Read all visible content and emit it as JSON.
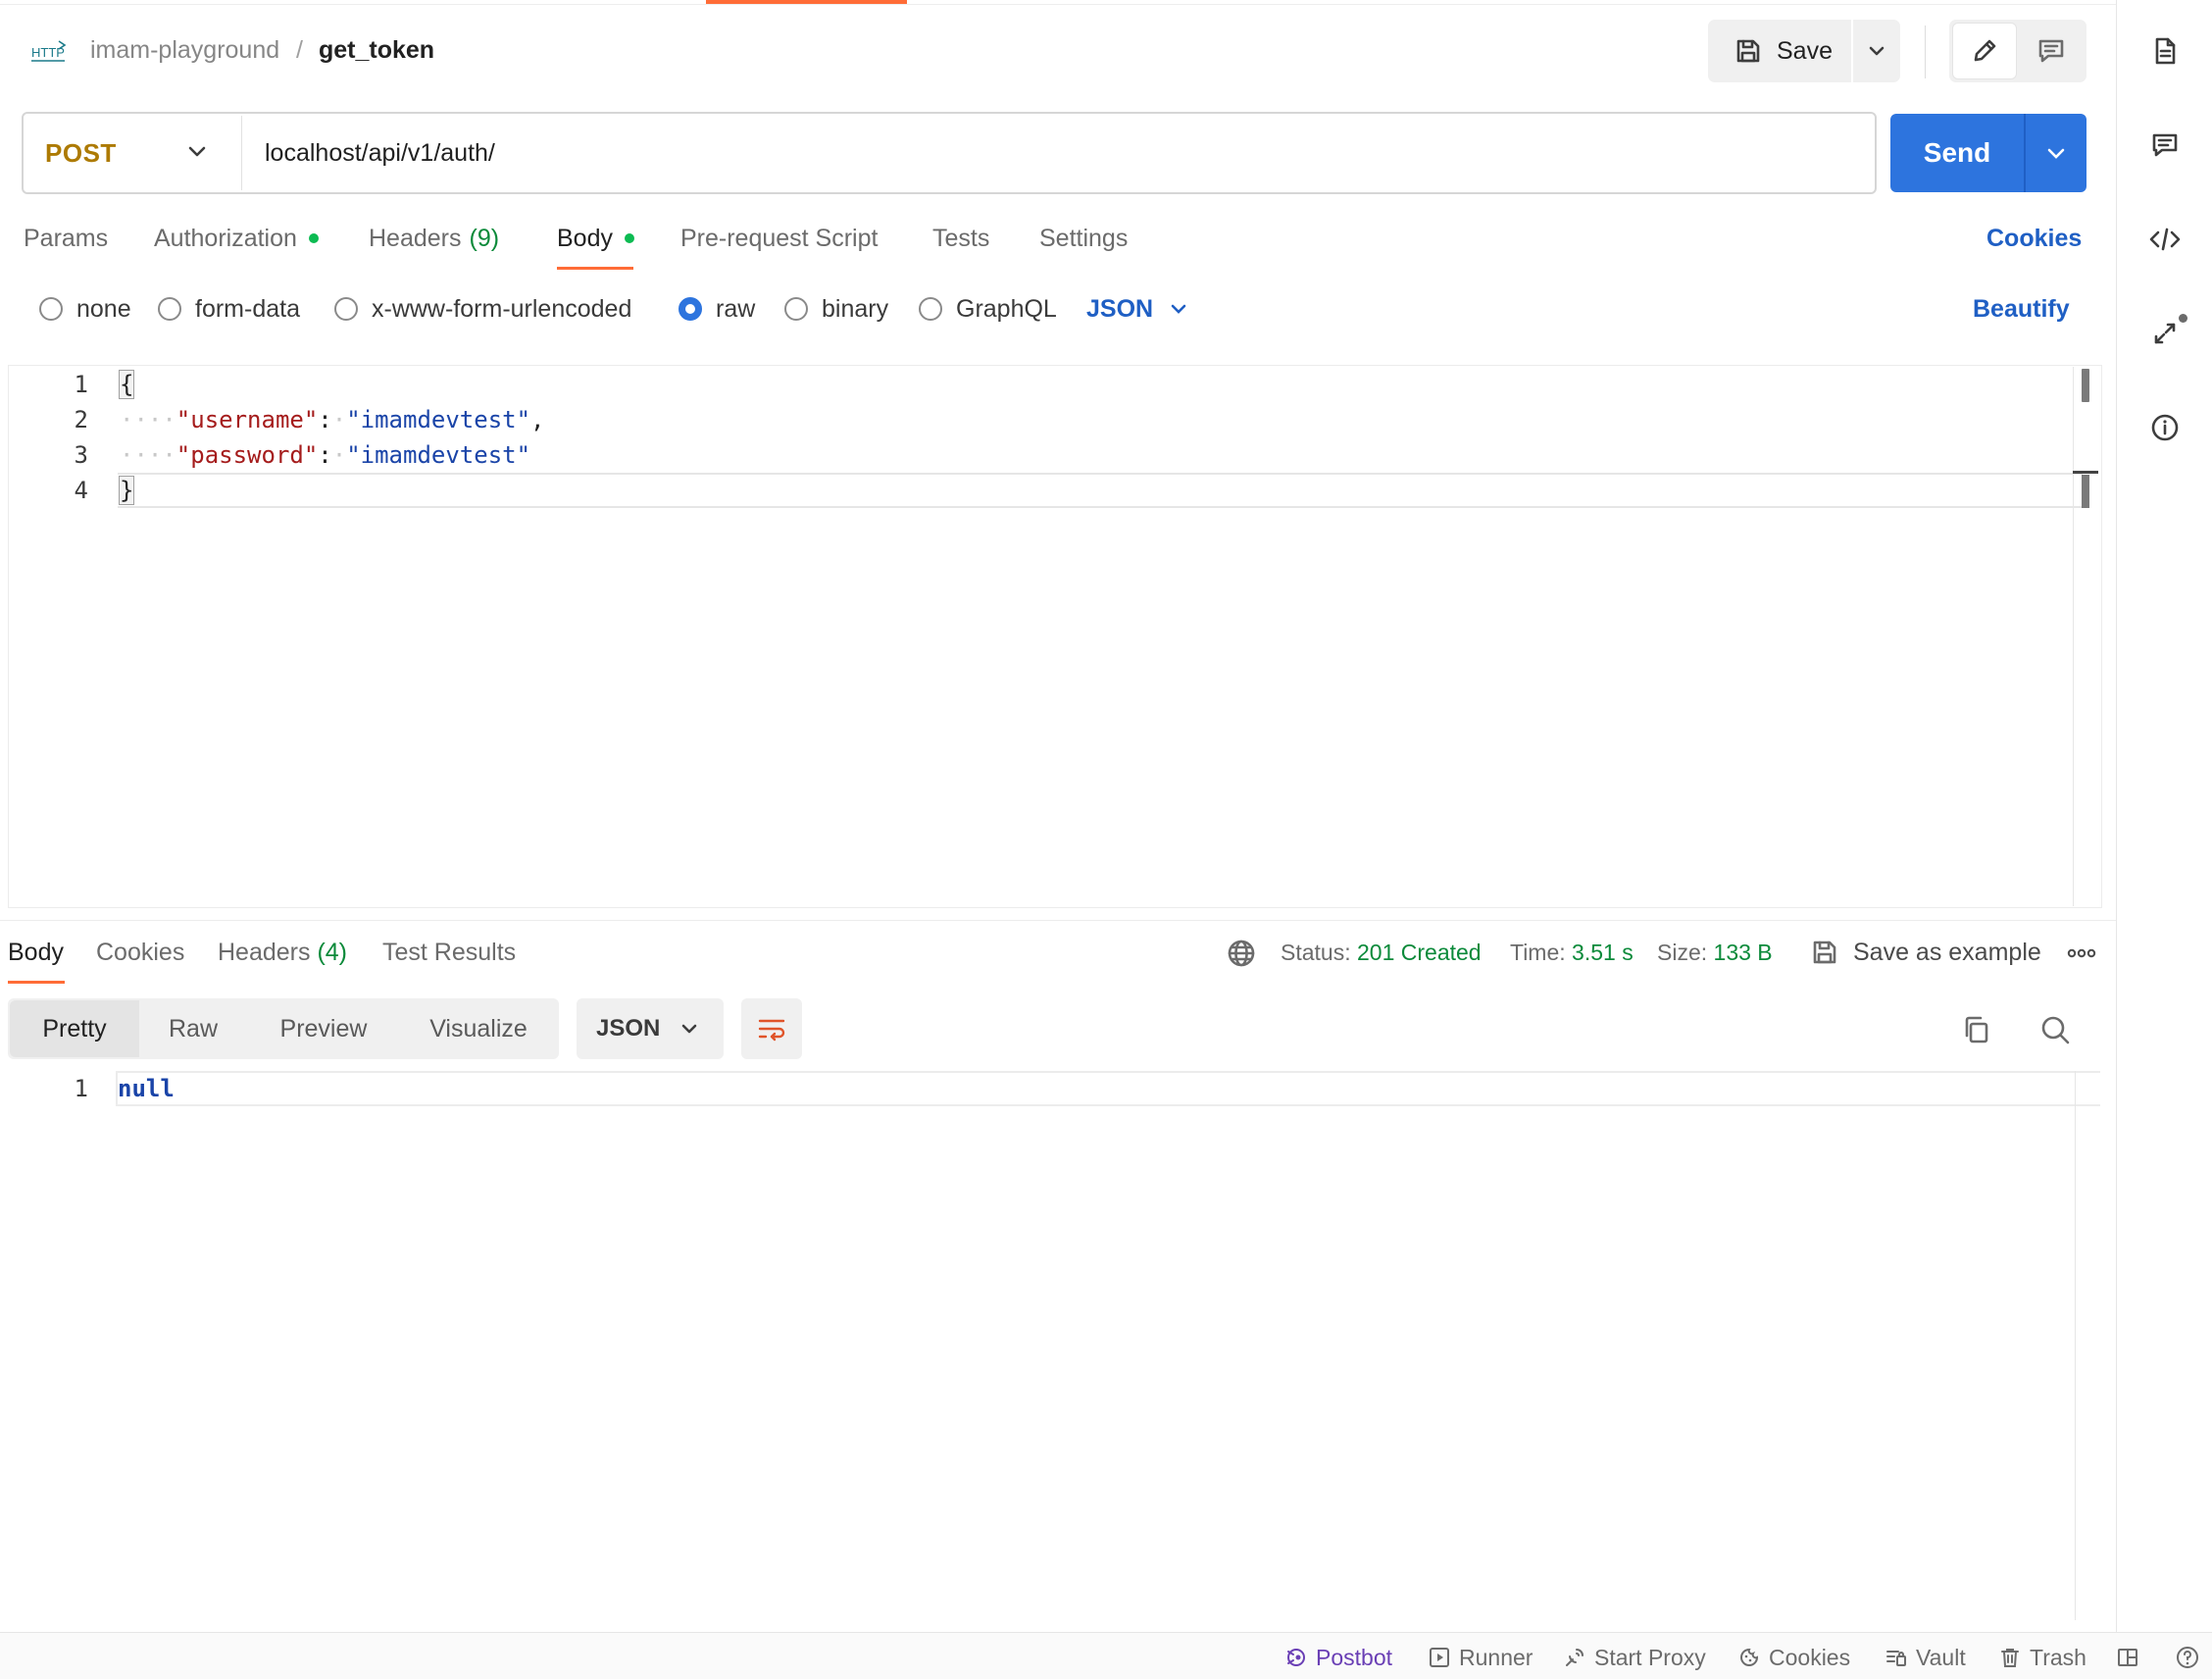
{
  "header": {
    "protocol_badge": "HTTP",
    "collection": "imam-playground",
    "separator": "/",
    "request_name": "get_token",
    "save_label": "Save"
  },
  "request": {
    "method": "POST",
    "url": "localhost/api/v1/auth/",
    "send_label": "Send",
    "tabs": [
      {
        "label": "Params"
      },
      {
        "label": "Authorization",
        "indicator": true
      },
      {
        "label": "Headers",
        "count": "(9)"
      },
      {
        "label": "Body",
        "indicator": true,
        "active": true
      },
      {
        "label": "Pre-request Script"
      },
      {
        "label": "Tests"
      },
      {
        "label": "Settings"
      }
    ],
    "cookies_link": "Cookies",
    "body_types": [
      {
        "label": "none",
        "selected": false
      },
      {
        "label": "form-data",
        "selected": false
      },
      {
        "label": "x-www-form-urlencoded",
        "selected": false
      },
      {
        "label": "raw",
        "selected": true
      },
      {
        "label": "binary",
        "selected": false
      },
      {
        "label": "GraphQL",
        "selected": false
      }
    ],
    "body_language": "JSON",
    "beautify_label": "Beautify",
    "editor": {
      "line_numbers": [
        "1",
        "2",
        "3",
        "4"
      ],
      "lines": [
        {
          "open": "{"
        },
        {
          "key": "\"username\"",
          "colon": ":",
          "value": "\"imamdevtest\"",
          "comma": ","
        },
        {
          "key": "\"password\"",
          "colon": ":",
          "value": "\"imamdevtest\""
        },
        {
          "close": "}"
        }
      ]
    }
  },
  "response": {
    "tabs": [
      {
        "label": "Body",
        "active": true
      },
      {
        "label": "Cookies"
      },
      {
        "label": "Headers",
        "count": "(4)"
      },
      {
        "label": "Test Results"
      }
    ],
    "status_label": "Status:",
    "status_value": "201 Created",
    "time_label": "Time:",
    "time_value": "3.51 s",
    "size_label": "Size:",
    "size_value": "133 B",
    "save_example_label": "Save as example",
    "views": [
      "Pretty",
      "Raw",
      "Preview",
      "Visualize"
    ],
    "active_view": "Pretty",
    "language": "JSON",
    "editor": {
      "line_numbers": [
        "1"
      ],
      "lines": [
        "null"
      ]
    }
  },
  "footer": {
    "items": [
      "Postbot",
      "Runner",
      "Start Proxy",
      "Cookies",
      "Vault",
      "Trash"
    ]
  },
  "colors": {
    "accent": "#ff6c37",
    "primary": "#2d74de",
    "method_post": "#ad7a03",
    "success": "#0b8a3a",
    "link": "#1f5fc4"
  }
}
